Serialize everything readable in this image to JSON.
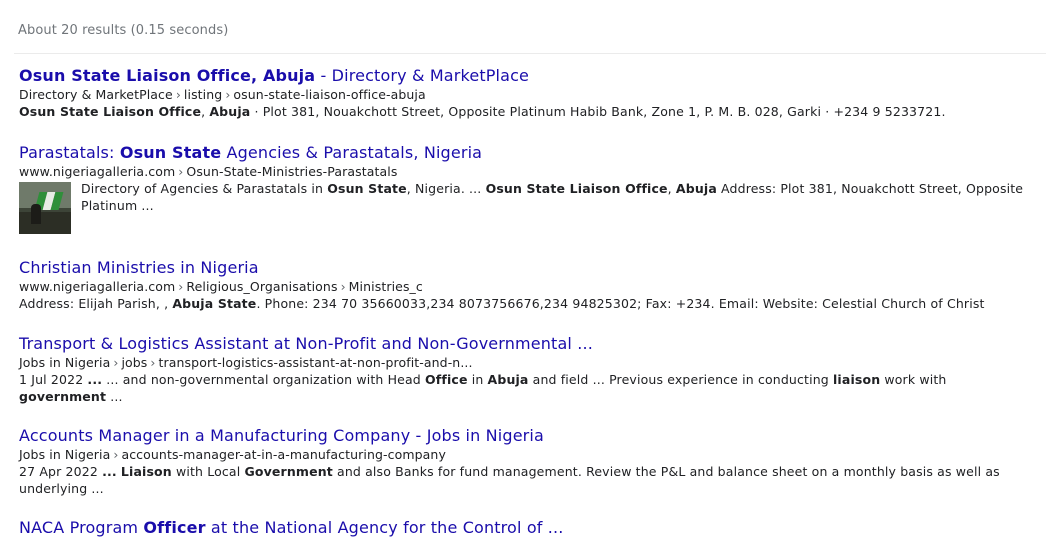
{
  "search_stats": "About 20 results (0.15 seconds)",
  "results": [
    {
      "title_parts": [
        {
          "t": "Osun State Liaison Office, Abuja",
          "b": true
        },
        {
          "t": " - Directory & MarketPlace",
          "b": false
        }
      ],
      "crumbs": [
        "Directory & MarketPlace",
        "listing",
        "osun-state-liaison-office-abuja"
      ],
      "snippet_parts": [
        {
          "t": "Osun State Liaison Office",
          "b": true
        },
        {
          "t": ", ",
          "b": false
        },
        {
          "t": "Abuja",
          "b": true
        },
        {
          "t": " · Plot 381, Nouakchott Street, Opposite Platinum Habib Bank, Zone 1, P. M. B. 028, Garki · +234 9 5233721.",
          "b": false
        }
      ],
      "has_thumbnail": false
    },
    {
      "title_parts": [
        {
          "t": "Parastatals: ",
          "b": false
        },
        {
          "t": "Osun State",
          "b": true
        },
        {
          "t": " Agencies & Parastatals, Nigeria",
          "b": false
        }
      ],
      "crumbs": [
        "www.nigeriagalleria.com",
        "Osun-State-Ministries-Parastatals"
      ],
      "snippet_parts": [
        {
          "t": "Directory of Agencies & Parastatals in ",
          "b": false
        },
        {
          "t": "Osun State",
          "b": true
        },
        {
          "t": ", Nigeria. ... ",
          "b": false
        },
        {
          "t": "Osun State Liaison Office",
          "b": true
        },
        {
          "t": ", ",
          "b": false
        },
        {
          "t": "Abuja",
          "b": true
        },
        {
          "t": " Address: Plot 381, Nouakchott Street, Opposite Platinum ...",
          "b": false
        }
      ],
      "has_thumbnail": true,
      "thumbnail_icon": "nigeria-flag-photo-thumbnail"
    },
    {
      "title_parts": [
        {
          "t": "Christian Ministries in Nigeria",
          "b": false
        }
      ],
      "crumbs": [
        "www.nigeriagalleria.com",
        "Religious_Organisations",
        "Ministries_c"
      ],
      "snippet_parts": [
        {
          "t": "Address: Elijah Parish, , ",
          "b": false
        },
        {
          "t": "Abuja State",
          "b": true
        },
        {
          "t": ". Phone: 234 70 35660033,234 8073756676,234 94825302; Fax: +234. Email: Website: Celestial Church of Christ",
          "b": false
        }
      ],
      "has_thumbnail": false
    },
    {
      "title_parts": [
        {
          "t": "Transport & Logistics Assistant at Non-Profit and Non-Governmental ...",
          "b": false
        }
      ],
      "crumbs": [
        "Jobs in Nigeria",
        "jobs",
        "transport-logistics-assistant-at-non-profit-and-n..."
      ],
      "snippet_parts": [
        {
          "t": "1 Jul 2022 ",
          "b": false
        },
        {
          "t": "...",
          "b": true
        },
        {
          "t": " ... and non-governmental organization with Head ",
          "b": false
        },
        {
          "t": "Office",
          "b": true
        },
        {
          "t": " in ",
          "b": false
        },
        {
          "t": "Abuja",
          "b": true
        },
        {
          "t": " and field ... Previous experience in conducting ",
          "b": false
        },
        {
          "t": "liaison",
          "b": true
        },
        {
          "t": " work with ",
          "b": false
        },
        {
          "t": "government",
          "b": true
        },
        {
          "t": " ...",
          "b": false
        }
      ],
      "has_thumbnail": false
    },
    {
      "title_parts": [
        {
          "t": "Accounts Manager in a Manufacturing Company - Jobs in Nigeria",
          "b": false
        }
      ],
      "crumbs": [
        "Jobs in Nigeria",
        "accounts-manager-at-in-a-manufacturing-company"
      ],
      "snippet_parts": [
        {
          "t": "27 Apr 2022 ",
          "b": false
        },
        {
          "t": "...",
          "b": true
        },
        {
          "t": " ",
          "b": false
        },
        {
          "t": "Liaison",
          "b": true
        },
        {
          "t": " with Local ",
          "b": false
        },
        {
          "t": "Government",
          "b": true
        },
        {
          "t": " and also Banks for fund management. Review the P&L and balance sheet on a monthly basis as well as underlying ...",
          "b": false
        }
      ],
      "has_thumbnail": false
    },
    {
      "title_parts": [
        {
          "t": "NACA Program ",
          "b": false
        },
        {
          "t": "Officer",
          "b": true
        },
        {
          "t": " at the National Agency for the Control of ...",
          "b": false
        }
      ],
      "crumbs": [],
      "snippet_parts": [],
      "has_thumbnail": false
    }
  ],
  "colors": {
    "link": "#1a0dab",
    "text": "#202124",
    "stats": "#70757a"
  }
}
